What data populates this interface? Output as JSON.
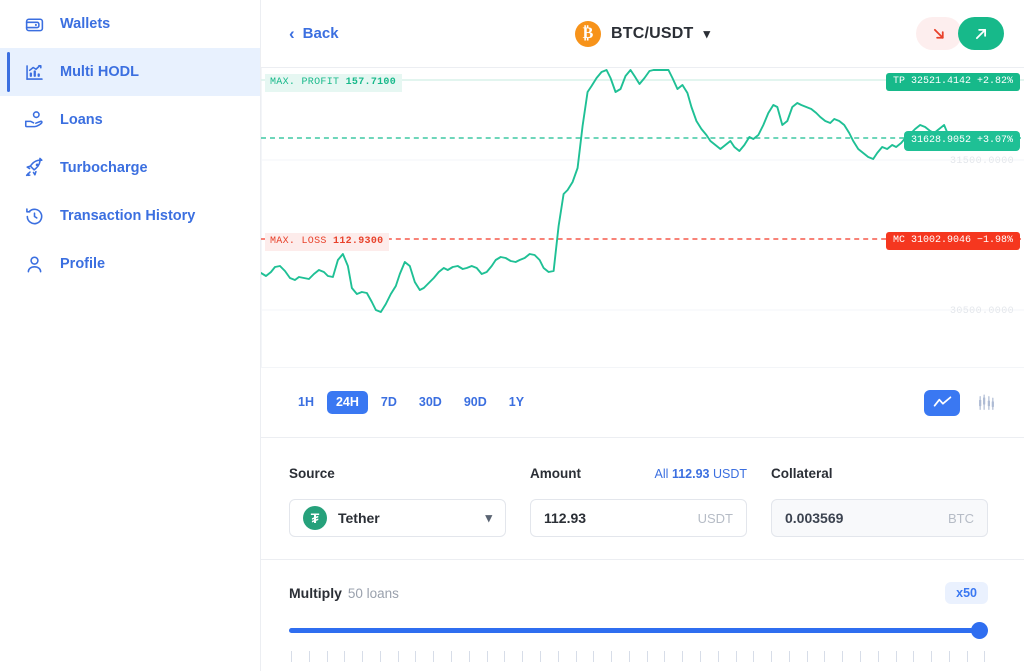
{
  "sidebar": {
    "items": [
      {
        "label": "Wallets",
        "icon": "wallet-icon",
        "active": false
      },
      {
        "label": "Multi HODL",
        "icon": "bar-chart-icon",
        "active": true
      },
      {
        "label": "Loans",
        "icon": "hand-coin-icon",
        "active": false
      },
      {
        "label": "Turbocharge",
        "icon": "rocket-icon",
        "active": false
      },
      {
        "label": "Transaction History",
        "icon": "clock-history-icon",
        "active": false
      },
      {
        "label": "Profile",
        "icon": "user-icon",
        "active": false
      }
    ]
  },
  "header": {
    "back_label": "Back",
    "back_icon": "chevron-left-icon",
    "pair": "BTC/USDT",
    "pair_chevron_icon": "chevron-down-icon",
    "coin_symbol": "₿",
    "coin_color": "#f7931a",
    "down_button_icon": "arrow-down-right-icon",
    "up_button_icon": "arrow-up-right-icon",
    "down_color": "#e8412a",
    "up_color": "#17b98a"
  },
  "chart": {
    "max_profit_label": "MAX. PROFIT",
    "max_profit_value": "157.7100",
    "max_loss_label": "MAX. LOSS",
    "max_loss_value": "112.9300",
    "tp_badge": "TP 32521.4142 +2.82%",
    "price_badge": "31628.9052 +3.07%",
    "mc_badge": "MC 31002.9046 −1.98%",
    "axis_label_top": "31500.0000",
    "axis_label_bottom": "30500.0000",
    "line_color": "#1fc095",
    "tp_color": "#17b98a",
    "mc_color": "#f5371f",
    "timeframes": [
      {
        "label": "1H",
        "active": false
      },
      {
        "label": "24H",
        "active": true
      },
      {
        "label": "7D",
        "active": false
      },
      {
        "label": "30D",
        "active": false
      },
      {
        "label": "90D",
        "active": false
      },
      {
        "label": "1Y",
        "active": false
      }
    ],
    "chart_types": [
      {
        "name": "line-chart-icon",
        "active": true
      },
      {
        "name": "candlestick-chart-icon",
        "active": false
      }
    ]
  },
  "chart_data": {
    "type": "line",
    "title": "BTC/USDT",
    "xlabel": "",
    "ylabel": "",
    "grid": true,
    "legend": false,
    "ylim": [
      30200,
      32100
    ],
    "y_ticks": [
      31500.0,
      30500.0
    ],
    "y_tick_labels": [
      "31500.0000",
      "30500.0000"
    ],
    "reference_lines": [
      {
        "name": "take-profit",
        "label": "TP 32521.4142 +2.82%",
        "value": 32521.4142,
        "color": "#17b98a",
        "style": "solid"
      },
      {
        "name": "current-price",
        "label": "31628.9052 +3.07%",
        "value": 31628.9052,
        "color": "#1fc095",
        "style": "dashed"
      },
      {
        "name": "margin-call",
        "label": "MC 31002.9046 −1.98%",
        "value": 31002.9046,
        "color": "#f5371f",
        "style": "dashed"
      }
    ],
    "annotations": [
      {
        "text": "MAX. PROFIT 157.7100",
        "color": "#17b98a"
      },
      {
        "text": "MAX. LOSS 112.9300",
        "color": "#e8412a"
      }
    ],
    "series": [
      {
        "name": "BTC/USDT price",
        "color": "#1fc095",
        "values": [
          30660,
          30650,
          30670,
          30695,
          30700,
          30675,
          30640,
          30630,
          30645,
          30640,
          30635,
          30660,
          30680,
          30670,
          30650,
          30645,
          30730,
          30760,
          30700,
          30590,
          30560,
          30570,
          30565,
          30520,
          30480,
          30470,
          30510,
          30560,
          30600,
          30660,
          30720,
          30700,
          30620,
          30580,
          30590,
          30615,
          30640,
          30670,
          30690,
          30680,
          30695,
          30700,
          30685,
          30690,
          30700,
          30690,
          30660,
          30670,
          30700,
          30730,
          30745,
          30740,
          30725,
          30720,
          30730,
          30740,
          30760,
          30755,
          30730,
          30690,
          30670,
          30675,
          30900,
          31060,
          31080,
          31120,
          31190,
          31400,
          31560,
          31590,
          31640,
          31800,
          31890,
          31800,
          31700,
          31720,
          31790,
          31840,
          31800,
          31760,
          31790,
          31830,
          31870,
          31900,
          31960,
          32000,
          31940,
          31880,
          31900,
          31860,
          31790,
          31720,
          31680,
          31650,
          31620,
          31600,
          31580,
          31600,
          31620,
          31590,
          31570,
          31600,
          31640,
          31630,
          31650,
          31700,
          31760,
          31800,
          31790,
          31700,
          31720,
          31790,
          31810,
          31800,
          31790,
          31780,
          31760,
          31740,
          31720,
          31710,
          31730,
          31720,
          31700,
          31660,
          31620,
          31580,
          31560,
          31540,
          31530,
          31560,
          31590,
          31580,
          31600,
          31590,
          31610,
          31640,
          31660,
          31680,
          31700,
          31690,
          31670,
          31660,
          31680,
          31700,
          31640,
          31629
        ]
      }
    ]
  },
  "form": {
    "source": {
      "label": "Source",
      "value": "Tether",
      "icon": "tether-icon",
      "chevron_icon": "chevron-down-icon"
    },
    "amount": {
      "label": "Amount",
      "all_prefix": "All",
      "all_value": "112.93",
      "all_unit": "USDT",
      "value": "112.93",
      "placeholder": "0.00",
      "unit": "USDT"
    },
    "collateral": {
      "label": "Collateral",
      "value": "0.003569",
      "unit": "BTC"
    }
  },
  "multiply": {
    "title": "Multiply",
    "subtitle": "50 loans",
    "badge": "x50",
    "slider_value": 50,
    "slider_min": 1,
    "slider_max": 50,
    "tick_count": 40
  }
}
